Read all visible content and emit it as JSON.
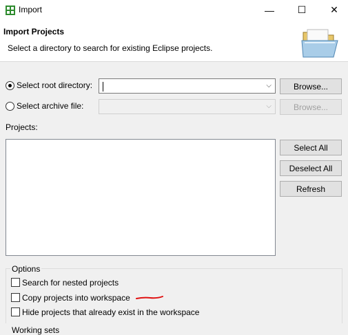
{
  "window": {
    "title": "Import",
    "min_glyph": "—",
    "max_glyph": "☐",
    "close_glyph": "✕"
  },
  "header": {
    "title": "Import Projects",
    "description": "Select a directory to search for existing Eclipse projects.",
    "icon": "open-folder-icon"
  },
  "source": {
    "root_label": "Select root directory:",
    "root_value": "",
    "root_selected": true,
    "archive_label": "Select archive file:",
    "archive_value": "",
    "archive_selected": false,
    "browse_label": "Browse...",
    "combo_arrow": "⌵"
  },
  "projects": {
    "label": "Projects:",
    "items": [],
    "select_all_label": "Select All",
    "deselect_all_label": "Deselect All",
    "refresh_label": "Refresh"
  },
  "options": {
    "legend": "Options",
    "nested_label": "Search for nested projects",
    "nested_checked": false,
    "copy_label": "Copy projects into workspace",
    "copy_checked": false,
    "hide_label": "Hide projects that already exist in the workspace",
    "hide_checked": false
  },
  "working_sets": {
    "label": "Working sets"
  },
  "colors": {
    "annotation": "#e01010",
    "app_icon": "#2e8b2e"
  }
}
